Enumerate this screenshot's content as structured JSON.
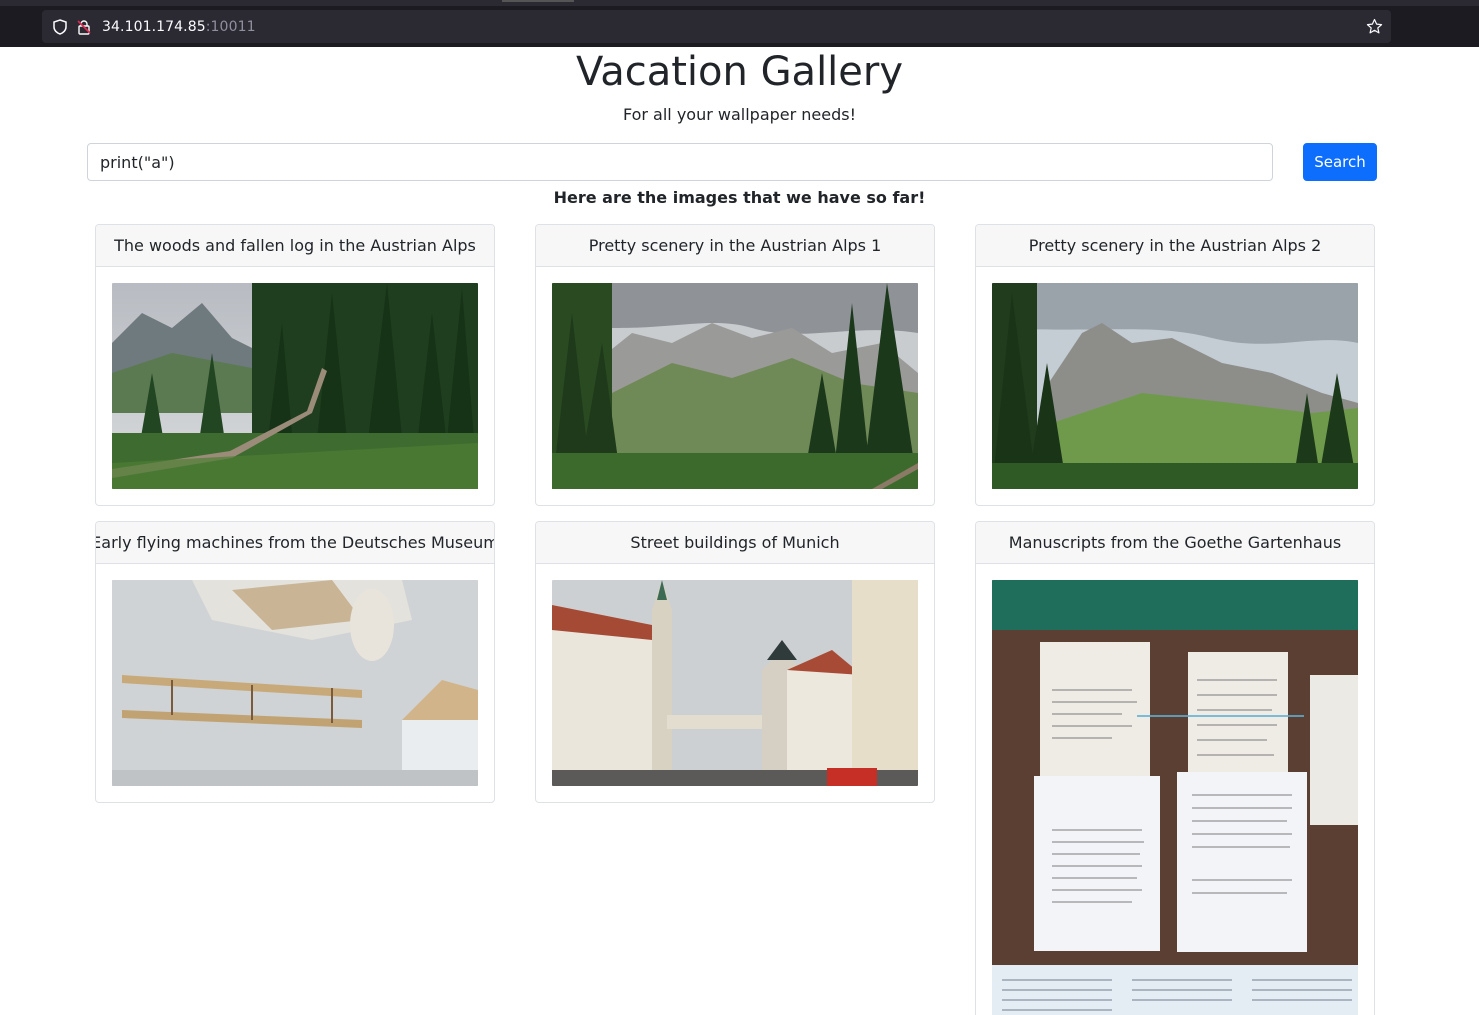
{
  "browser": {
    "url_host": "34.101.174.85",
    "url_port": ":10011"
  },
  "page": {
    "title": "Vacation Gallery",
    "subtitle": "For all your wallpaper needs!",
    "intro": "Here are the images that we have so far!"
  },
  "search": {
    "value": "print(\"a\")",
    "button_label": "Search"
  },
  "gallery": [
    {
      "caption": "The woods and fallen log in the Austrian Alps"
    },
    {
      "caption": "Pretty scenery in the Austrian Alps 1"
    },
    {
      "caption": "Pretty scenery in the Austrian Alps 2"
    },
    {
      "caption": "Early flying machines from the Deutsches Museum"
    },
    {
      "caption": "Street buildings of Munich"
    },
    {
      "caption": "Manuscripts from the Goethe Gartenhaus"
    }
  ],
  "colors": {
    "accent": "#0d6efd",
    "card_header_bg": "#f7f7f7"
  }
}
